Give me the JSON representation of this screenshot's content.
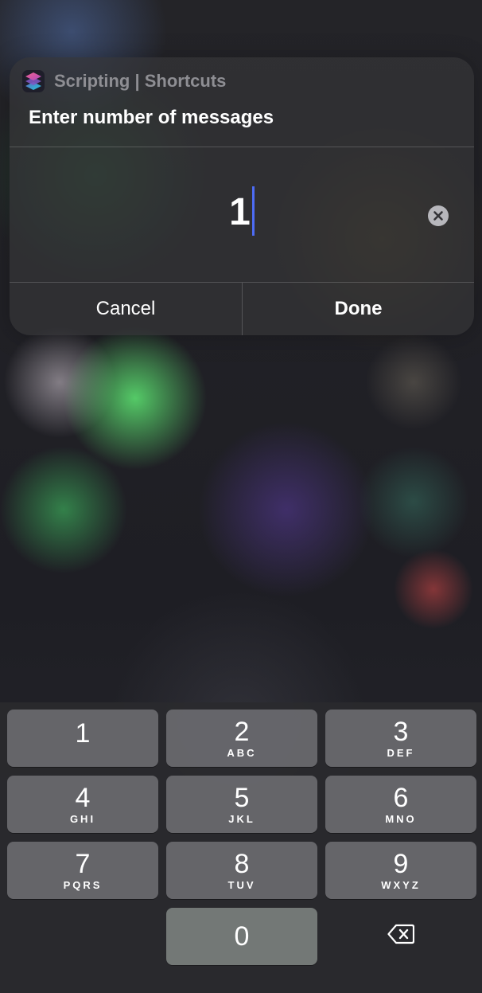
{
  "alert": {
    "app_icon": "shortcuts-app-icon",
    "app_name": "Scripting | Shortcuts",
    "title": "Enter number of messages",
    "input_value": "1",
    "clear_icon": "clear-x-icon",
    "cancel_label": "Cancel",
    "done_label": "Done"
  },
  "keypad": {
    "keys": [
      {
        "digit": "1",
        "letters": ""
      },
      {
        "digit": "2",
        "letters": "ABC"
      },
      {
        "digit": "3",
        "letters": "DEF"
      },
      {
        "digit": "4",
        "letters": "GHI"
      },
      {
        "digit": "5",
        "letters": "JKL"
      },
      {
        "digit": "6",
        "letters": "MNO"
      },
      {
        "digit": "7",
        "letters": "PQRS"
      },
      {
        "digit": "8",
        "letters": "TUV"
      },
      {
        "digit": "9",
        "letters": "WXYZ"
      },
      {
        "digit": "0",
        "letters": ""
      }
    ],
    "backspace_icon": "backspace-icon"
  },
  "colors": {
    "caret": "#4d6cf5",
    "app_name": "#8e8e93",
    "key_background": "#707074"
  }
}
